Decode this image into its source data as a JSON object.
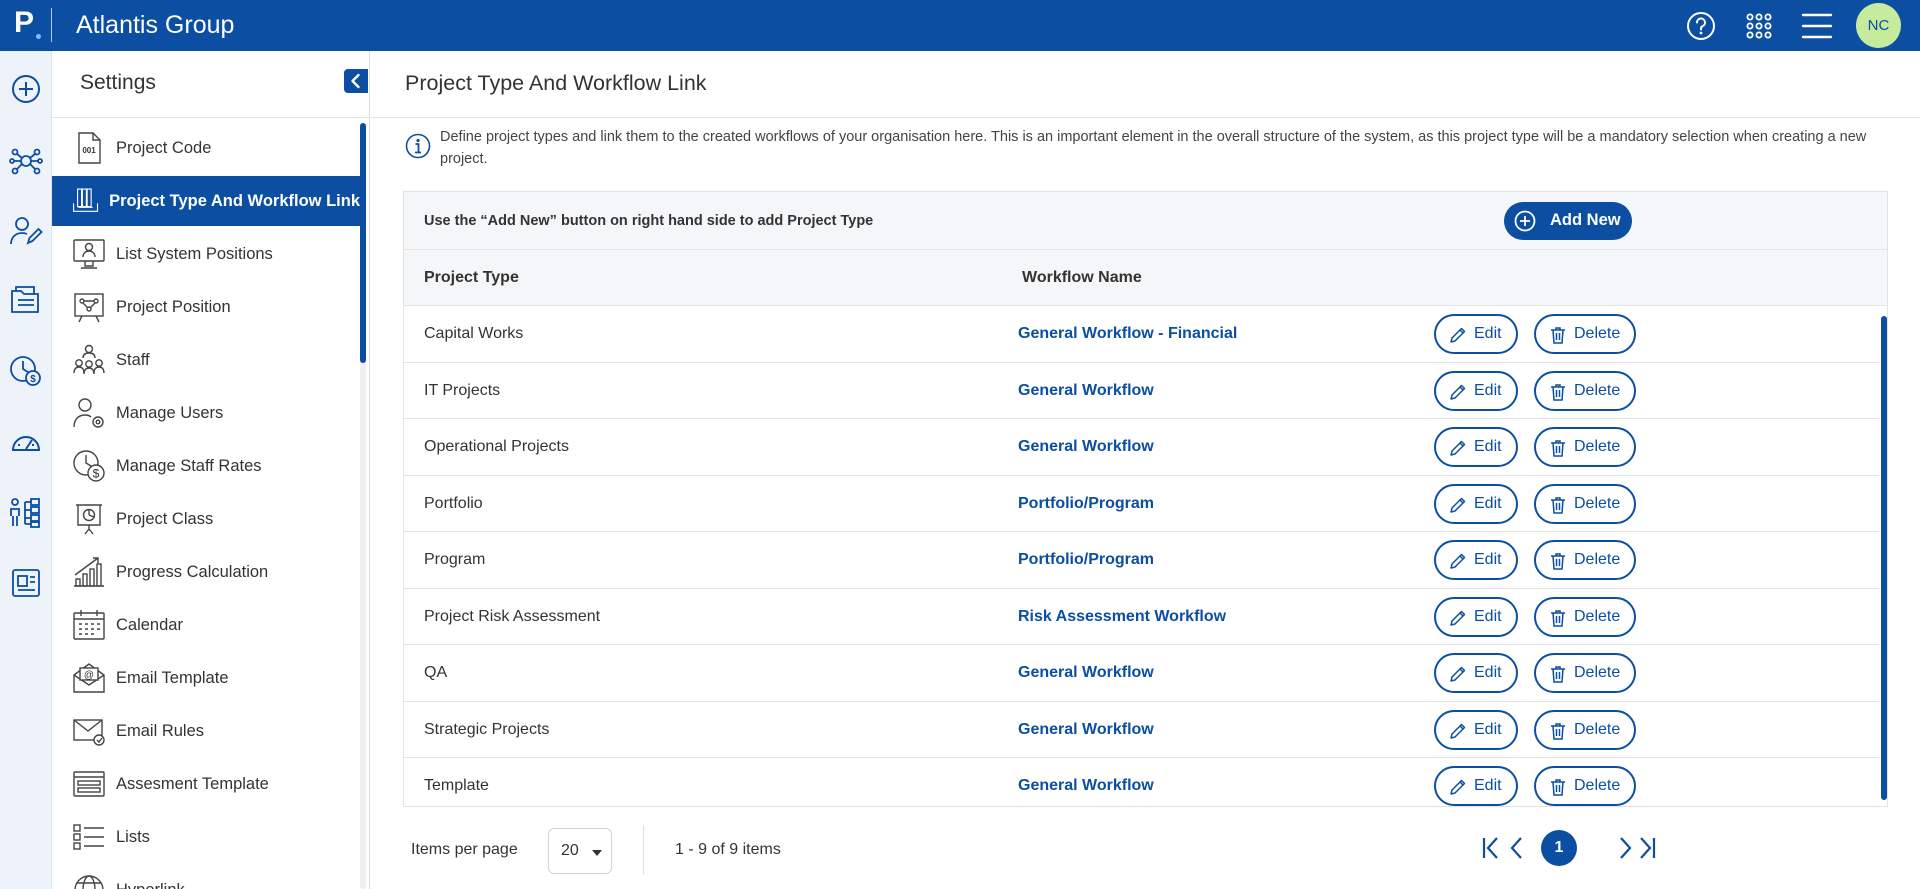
{
  "app": {
    "logo": "P",
    "title": "Atlantis Group",
    "user_initials": "NC"
  },
  "topbar_icons": [
    "help-icon",
    "apps-grid-icon",
    "hamburger-menu-icon"
  ],
  "rail_icons": [
    "add-circle-icon",
    "network-icon",
    "user-edit-icon",
    "documents-icon",
    "clock-dollar-icon",
    "gauge-icon",
    "org-chart-icon",
    "report-icon"
  ],
  "settings": {
    "title": "Settings",
    "items": [
      {
        "label": "Project Code",
        "icon": "code-doc-icon"
      },
      {
        "label": "Project Type And Workflow Link",
        "icon": "binders-icon",
        "active": true
      },
      {
        "label": "List System Positions",
        "icon": "monitor-user-icon"
      },
      {
        "label": "Project Position",
        "icon": "board-icon"
      },
      {
        "label": "Staff",
        "icon": "staff-group-icon"
      },
      {
        "label": "Manage Users",
        "icon": "user-gear-icon"
      },
      {
        "label": "Manage Staff Rates",
        "icon": "clock-dollar-icon"
      },
      {
        "label": "Project Class",
        "icon": "presentation-pie-icon"
      },
      {
        "label": "Progress Calculation",
        "icon": "growth-chart-icon"
      },
      {
        "label": "Calendar",
        "icon": "calendar-icon"
      },
      {
        "label": "Email Template",
        "icon": "email-at-icon"
      },
      {
        "label": "Email Rules",
        "icon": "email-rules-icon"
      },
      {
        "label": "Assesment Template",
        "icon": "template-icon"
      },
      {
        "label": "Lists",
        "icon": "list-icon"
      },
      {
        "label": "Hyperlink",
        "icon": "globe-icon"
      }
    ]
  },
  "main": {
    "title": "Project Type And Workflow Link",
    "info": "Define project types and link them to the created workflows of your organisation here. This is an important element in the overall structure of the system, as this project type will be a mandatory selection when creating a new project.",
    "toolbar_text": "Use the “Add New” button on right hand side to add Project Type",
    "add_label": "Add New",
    "columns": {
      "type": "Project Type",
      "workflow": "Workflow Name"
    },
    "edit_label": "Edit",
    "delete_label": "Delete",
    "rows": [
      {
        "type": "Capital Works",
        "workflow": "General Workflow - Financial"
      },
      {
        "type": "IT Projects",
        "workflow": "General Workflow"
      },
      {
        "type": "Operational Projects",
        "workflow": "General Workflow"
      },
      {
        "type": "Portfolio",
        "workflow": "Portfolio/Program"
      },
      {
        "type": "Program",
        "workflow": "Portfolio/Program"
      },
      {
        "type": "Project Risk Assessment",
        "workflow": "Risk Assessment Workflow"
      },
      {
        "type": "QA",
        "workflow": "General Workflow"
      },
      {
        "type": "Strategic Projects",
        "workflow": "General Workflow"
      },
      {
        "type": "Template",
        "workflow": "General Workflow"
      }
    ]
  },
  "pager": {
    "label": "Items per page",
    "page_size": "20",
    "info": "1 - 9 of 9 items",
    "current_page": "1"
  },
  "colors": {
    "brand": "#0b4ea2",
    "avatar_bg": "#c6eb9d",
    "rail_bg": "#eef2f9"
  }
}
